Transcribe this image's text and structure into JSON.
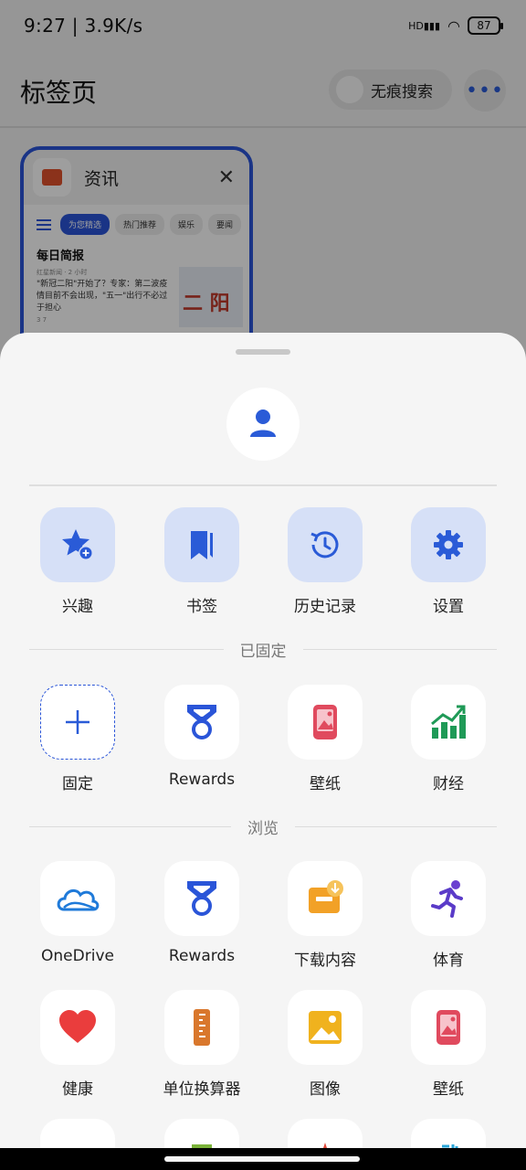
{
  "status_bar": {
    "time": "9:27 | 3.9K/s",
    "battery": "87",
    "net": "HD"
  },
  "header": {
    "title": "标签页",
    "incognito_label": "无痕搜索",
    "more_label": "•••"
  },
  "tab_card": {
    "title": "资讯",
    "close": "✕",
    "chips": [
      "为您精选",
      "热门推荐",
      "娱乐",
      "要闻"
    ],
    "brief_title": "每日简报",
    "news_source": "红星新闻 · 2 小时",
    "news_text": "\"新冠二阳\"开始了？专家：第二波疫情目前不会出现，\"五一\"出行不必过于担心",
    "news_meta": "3   7",
    "image_text": "二 阳"
  },
  "quick_actions": [
    {
      "label": "兴趣",
      "icon": "star-add-icon"
    },
    {
      "label": "书签",
      "icon": "bookmark-icon"
    },
    {
      "label": "历史记录",
      "icon": "history-icon"
    },
    {
      "label": "设置",
      "icon": "gear-icon"
    }
  ],
  "pinned_section": {
    "title": "已固定",
    "items": [
      {
        "label": "固定",
        "icon": "plus-icon"
      },
      {
        "label": "Rewards",
        "icon": "medal-icon"
      },
      {
        "label": "壁纸",
        "icon": "wallpaper-icon"
      },
      {
        "label": "财经",
        "icon": "finance-chart-icon"
      }
    ]
  },
  "browse_section": {
    "title": "浏览",
    "items": [
      {
        "label": "OneDrive",
        "icon": "cloud-icon"
      },
      {
        "label": "Rewards",
        "icon": "medal-icon"
      },
      {
        "label": "下载内容",
        "icon": "download-box-icon"
      },
      {
        "label": "体育",
        "icon": "runner-icon"
      },
      {
        "label": "健康",
        "icon": "heart-icon"
      },
      {
        "label": "单位换算器",
        "icon": "ruler-icon"
      },
      {
        "label": "图像",
        "icon": "image-icon"
      },
      {
        "label": "壁纸",
        "icon": "wallpaper-icon"
      }
    ]
  },
  "colors": {
    "accent": "#2a55d8",
    "sheet_bg": "#f5f5f5",
    "quick_bg": "#d6e0f7"
  }
}
